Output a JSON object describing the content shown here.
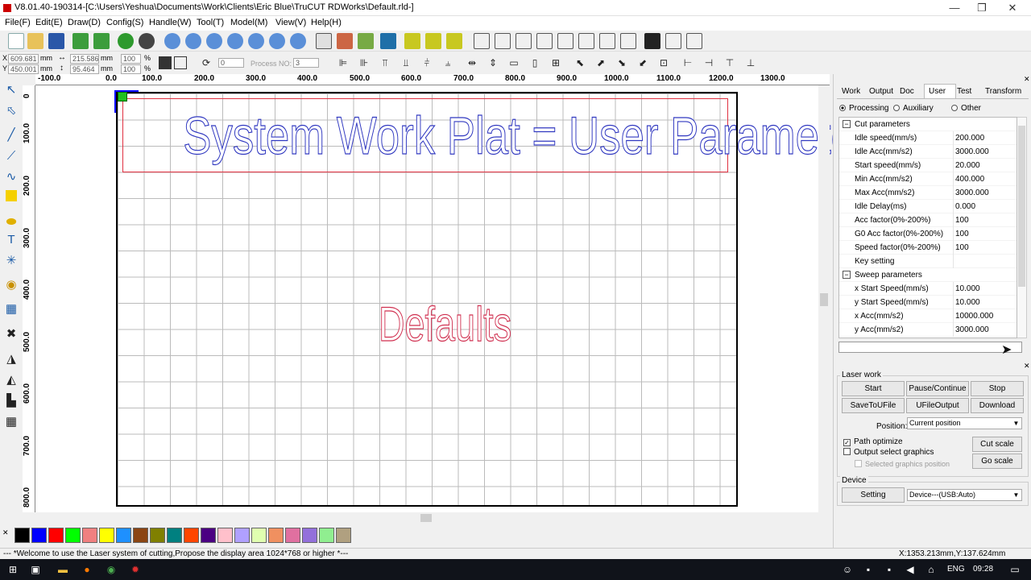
{
  "window": {
    "title": "V8.01.40-190314-[C:\\Users\\Yeshua\\Documents\\Work\\Clients\\Eric Blue\\TruCUT RDWorks\\Default.rld-]",
    "minimize": "—",
    "maximize": "❐",
    "close": "✕"
  },
  "menu": [
    "File(F)",
    "Edit(E)",
    "Draw(D)",
    "Config(S)",
    "Handle(W)",
    "Tool(T)",
    "Model(M)",
    "View(V)",
    "Help(H)"
  ],
  "toolbar2": {
    "x_label": "X",
    "x_value": "609.681",
    "x_unit": "mm",
    "y_label": "Y",
    "y_value": "450.001",
    "y_unit": "mm",
    "w_value": "215.586",
    "w_unit": "mm",
    "h_value": "95.464",
    "h_unit": "mm",
    "w_pct": "100",
    "h_pct": "100",
    "pct": "%",
    "rotate_value": "0",
    "process_no_label": "Process NO:",
    "process_no_value": "3"
  },
  "ruler": {
    "h": [
      "-100.0",
      "0.0",
      "100.0",
      "200.0",
      "300.0",
      "400.0",
      "500.0",
      "600.0",
      "700.0",
      "800.0",
      "900.0",
      "1000.0",
      "1100.0",
      "1200.0",
      "1300.0"
    ],
    "v": [
      "0",
      "100.0",
      "200.0",
      "300.0",
      "400.0",
      "500.0",
      "600.0",
      "700.0",
      "800.0"
    ]
  },
  "canvas": {
    "title_text": "System Work Plat = User Parameters",
    "center_text": "Defaults"
  },
  "palette": [
    "#000000",
    "#0000ff",
    "#ff0000",
    "#00ff00",
    "#f08080",
    "#ffff00",
    "#1e90ff",
    "#8b4513",
    "#808000",
    "#008080",
    "#ff4500",
    "#4b0082",
    "#ffc0cb",
    "#b0a0ff",
    "#e0ffb0",
    "#f09060",
    "#e070a0",
    "#9370db",
    "#90ee90",
    "#b0a080"
  ],
  "palette_x": "✕",
  "status": {
    "message": "--- *Welcome to use the Laser system of cutting,Propose the display area 1024*768 or higher *---",
    "coords": "X:1353.213mm,Y:137.624mm"
  },
  "panel": {
    "tabs": [
      "Work",
      "Output",
      "Doc",
      "User",
      "Test",
      "Transform"
    ],
    "active_tab": "User",
    "radios": [
      "Processing",
      "Auxiliary",
      "Other"
    ],
    "groups": [
      {
        "name": "Cut parameters",
        "rows": [
          {
            "name": "Idle speed(mm/s)",
            "value": "200.000"
          },
          {
            "name": "Idle Acc(mm/s2)",
            "value": "3000.000"
          },
          {
            "name": "Start speed(mm/s)",
            "value": "20.000"
          },
          {
            "name": "Min Acc(mm/s2)",
            "value": "400.000"
          },
          {
            "name": "Max Acc(mm/s2)",
            "value": "3000.000"
          },
          {
            "name": "Idle Delay(ms)",
            "value": "0.000"
          },
          {
            "name": "Acc factor(0%-200%)",
            "value": "100"
          },
          {
            "name": "G0 Acc factor(0%-200%)",
            "value": "100"
          },
          {
            "name": "Speed factor(0%-200%)",
            "value": "100"
          },
          {
            "name": "Key setting",
            "value": ""
          }
        ]
      },
      {
        "name": "Sweep parameters",
        "rows": [
          {
            "name": "x Start Speed(mm/s)",
            "value": "10.000"
          },
          {
            "name": "y Start Speed(mm/s)",
            "value": "10.000"
          },
          {
            "name": "x Acc(mm/s2)",
            "value": "10000.000"
          },
          {
            "name": "y Acc(mm/s2)",
            "value": "3000.000"
          }
        ]
      }
    ],
    "laser_work": {
      "title": "Laser work",
      "start": "Start",
      "pause": "Pause/Continue",
      "stop": "Stop",
      "save_to_file": "SaveToUFile",
      "ufile_output": "UFileOutput",
      "download": "Download",
      "position_label": "Position:",
      "position_value": "Current position",
      "path_optimize": "Path optimize",
      "output_select": "Output select graphics",
      "selected_position": "Selected graphics position",
      "cut_scale": "Cut scale",
      "go_scale": "Go scale"
    },
    "device": {
      "title": "Device",
      "setting": "Setting",
      "device_value": "Device---(USB:Auto)"
    }
  },
  "taskbar": {
    "time": "09:28",
    "lang": "ENG"
  }
}
